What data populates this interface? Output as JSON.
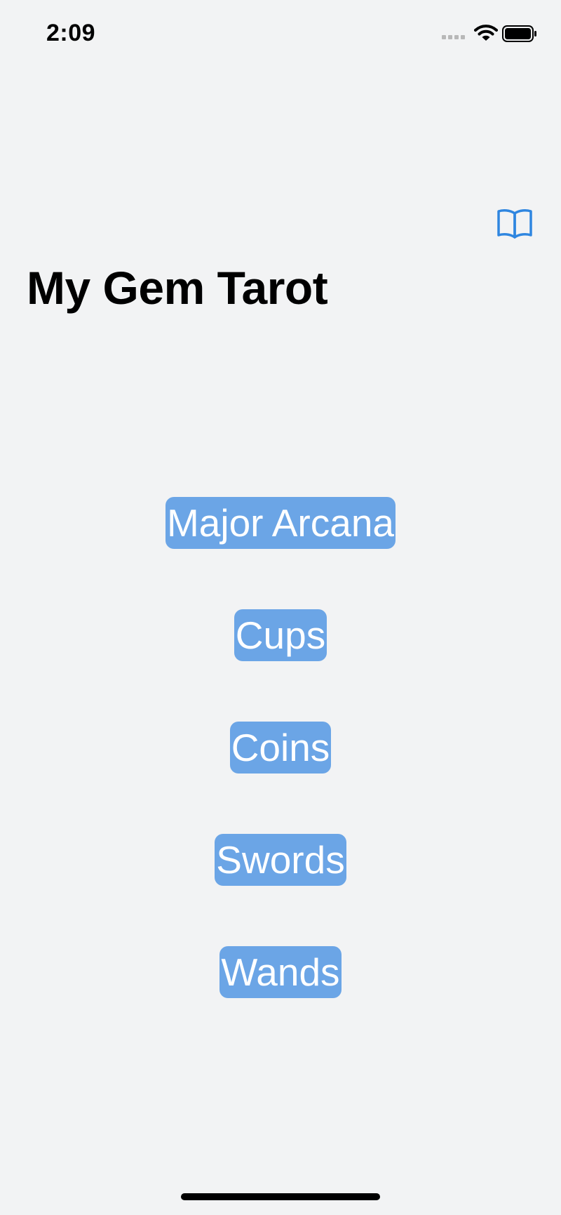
{
  "status_bar": {
    "time": "2:09",
    "icons": [
      "cellular-signal-icon",
      "wifi-icon",
      "battery-icon"
    ]
  },
  "nav": {
    "action_icon": "book-icon"
  },
  "page": {
    "title": "My Gem Tarot"
  },
  "menu": {
    "items": [
      {
        "label": "Major Arcana"
      },
      {
        "label": "Cups"
      },
      {
        "label": "Coins"
      },
      {
        "label": "Swords"
      },
      {
        "label": "Wands"
      }
    ]
  },
  "colors": {
    "background": "#f2f3f4",
    "accent": "#2f86e0",
    "button_fill": "#6ba5e6",
    "button_text": "#ffffff"
  }
}
